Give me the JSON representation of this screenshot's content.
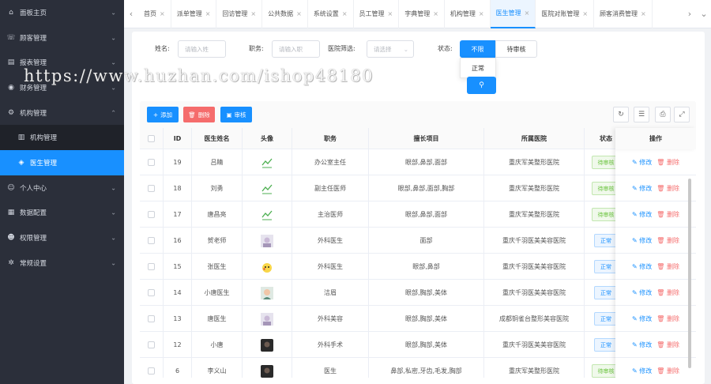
{
  "watermark": "https://www.huzhan.com/ishop48180",
  "sidebar": {
    "items": [
      {
        "icon": "home-icon",
        "glyph": "⌂",
        "label": "面板主页",
        "chev": "⌄"
      },
      {
        "icon": "phone-icon",
        "glyph": "☏",
        "label": "顾客管理",
        "chev": "⌄"
      },
      {
        "icon": "report-icon",
        "glyph": "▤",
        "label": "报表管理",
        "chev": "⌄"
      },
      {
        "icon": "finance-icon",
        "glyph": "◉",
        "label": "财务管理",
        "chev": "⌄"
      },
      {
        "icon": "gear-icon",
        "glyph": "⚙",
        "label": "机构管理",
        "chev": "⌃"
      },
      {
        "icon": "building-icon",
        "glyph": "▥",
        "label": "机构管理",
        "sub": true
      },
      {
        "icon": "cube-icon",
        "glyph": "◈",
        "label": "医生管理",
        "sub": true,
        "active": true
      },
      {
        "icon": "user-icon",
        "glyph": "☺",
        "label": "个人中心",
        "chev": "⌄"
      },
      {
        "icon": "data-icon",
        "glyph": "▦",
        "label": "数据配置",
        "chev": "⌄"
      },
      {
        "icon": "permission-icon",
        "glyph": "☻",
        "label": "权限管理",
        "chev": "⌄"
      },
      {
        "icon": "settings-icon",
        "glyph": "✲",
        "label": "常规设置",
        "chev": "⌄"
      }
    ]
  },
  "tabs": [
    {
      "label": "首页",
      "active": false
    },
    {
      "label": "派单管理",
      "active": false
    },
    {
      "label": "回访管理",
      "active": false
    },
    {
      "label": "公共数据",
      "active": false
    },
    {
      "label": "系统设置",
      "active": false
    },
    {
      "label": "员工管理",
      "active": false
    },
    {
      "label": "字典管理",
      "active": false
    },
    {
      "label": "机构管理",
      "active": false
    },
    {
      "label": "医生管理",
      "active": true
    },
    {
      "label": "医院对账管理",
      "active": false
    },
    {
      "label": "顾客消费管理",
      "active": false
    }
  ],
  "filters": {
    "name_label": "姓名:",
    "name_placeholder": "请输入姓",
    "position_label": "职务:",
    "position_placeholder": "请输入职",
    "hospital_label": "医院筛选:",
    "hospital_placeholder": "请选择",
    "status_label": "状态:",
    "status_options": [
      "不限",
      "待审核"
    ],
    "dropdown_option": "正常"
  },
  "toolbar": {
    "add": "添加",
    "delete": "删除",
    "audit": "审核",
    "colors": {
      "add": "#1890ff",
      "delete": "#f56c6c",
      "audit": "#1890ff"
    }
  },
  "table": {
    "columns": [
      "ID",
      "医生姓名",
      "头像",
      "职务",
      "擅长项目",
      "所属医院",
      "状态",
      "操作"
    ],
    "edit_label": "修改",
    "delete_label": "删除",
    "rows": [
      {
        "id": "19",
        "name": "吕睛",
        "title": "办公室主任",
        "skills": "眼部,鼻部,面部",
        "hospital": "重庆军美整形医院",
        "status": "待审核",
        "status_type": "pending",
        "avatar": "chart"
      },
      {
        "id": "18",
        "name": "刘勇",
        "title": "副主任医师",
        "skills": "眼部,鼻部,面部,胸部",
        "hospital": "重庆军美整形医院",
        "status": "待审核",
        "status_type": "pending",
        "avatar": "chart"
      },
      {
        "id": "17",
        "name": "唐昌亮",
        "title": "主治医师",
        "skills": "眼部,鼻部,面部",
        "hospital": "重庆军美整形医院",
        "status": "待审核",
        "status_type": "pending",
        "avatar": "chart"
      },
      {
        "id": "16",
        "name": "贺老师",
        "title": "外科医生",
        "skills": "面部",
        "hospital": "重庆千羽医美美容医院",
        "status": "正常",
        "status_type": "normal",
        "avatar": "photo"
      },
      {
        "id": "15",
        "name": "张医生",
        "title": "外科医生",
        "skills": "眼部,鼻部",
        "hospital": "重庆千羽医美美容医院",
        "status": "正常",
        "status_type": "normal",
        "avatar": "pikachu"
      },
      {
        "id": "14",
        "name": "小唐医生",
        "title": "洁眉",
        "skills": "眼部,胸部,美体",
        "hospital": "重庆千羽医美美容医院",
        "status": "正常",
        "status_type": "normal",
        "avatar": "face"
      },
      {
        "id": "13",
        "name": "唐医生",
        "title": "外科美容",
        "skills": "眼部,胸部,美体",
        "hospital": "成都铜雀台整形美容医院",
        "status": "正常",
        "status_type": "normal",
        "avatar": "photo"
      },
      {
        "id": "12",
        "name": "小唐",
        "title": "外科手术",
        "skills": "眼部,胸部,美体",
        "hospital": "重庆千羽医美美容医院",
        "status": "正常",
        "status_type": "normal",
        "avatar": "dark"
      },
      {
        "id": "6",
        "name": "李义山",
        "title": "医生",
        "skills": "鼻部,私密,牙齿,毛发,胸部",
        "hospital": "重庆军美整形医院",
        "status": "待审核",
        "status_type": "pending",
        "avatar": "dark"
      }
    ]
  }
}
